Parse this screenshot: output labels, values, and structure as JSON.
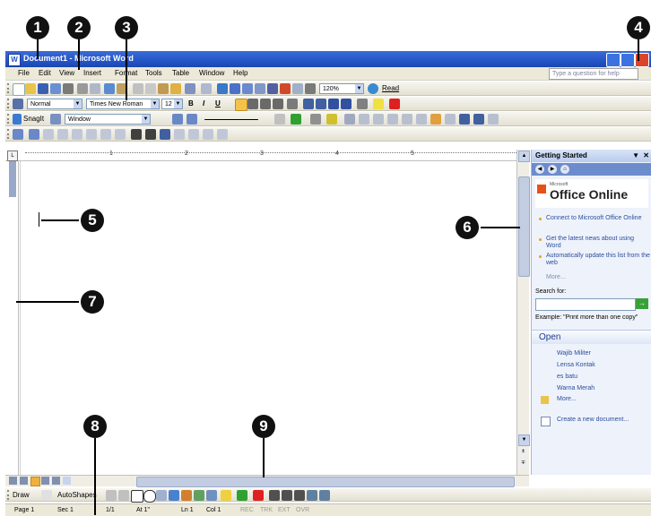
{
  "window": {
    "title": "Document1 - Microsoft Word",
    "app_icon": "W"
  },
  "menu": [
    "File",
    "Edit",
    "View",
    "Insert",
    "Format",
    "Tools",
    "Table",
    "Window",
    "Help"
  ],
  "ask_placeholder": "Type a question for help",
  "formatting": {
    "style": "Normal",
    "font": "Times New Roman",
    "size": "12",
    "bold": "B",
    "italic": "I",
    "underline": "U"
  },
  "standard": {
    "zoom": "120%",
    "read_label": "Read"
  },
  "snagit": {
    "label": "SnagIt",
    "capture": "Window"
  },
  "ruler_numbers": [
    "1",
    "2",
    "3",
    "4",
    "5"
  ],
  "task_pane": {
    "title": "Getting Started",
    "logo_small": "Microsoft",
    "logo": "Office Online",
    "links": [
      "Connect to Microsoft Office Online",
      "Get the latest news about using Word",
      "Automatically update this list from the web",
      "More..."
    ],
    "search_label": "Search for:",
    "search_go": "→",
    "example": "Example:  \"Print more than one copy\"",
    "open_title": "Open",
    "files": [
      "Wajib Militer",
      "Lensa Kontak",
      "es batu",
      "Warna Merah",
      "More..."
    ],
    "create": "Create a new document..."
  },
  "draw_toolbar": {
    "draw": "Draw",
    "autoshapes": "AutoShapes"
  },
  "status": {
    "page": "Page 1",
    "sec": "Sec 1",
    "pages": "1/1",
    "at": "At 1\"",
    "ln": "Ln 1",
    "col": "Col 1",
    "rec": "REC",
    "trk": "TRK",
    "ext": "EXT",
    "ovr": "OVR"
  },
  "callouts": [
    "1",
    "2",
    "3",
    "4",
    "5",
    "6",
    "7",
    "8",
    "9"
  ],
  "colors": {
    "title_bar": "#2456c8",
    "close_button": "#d9442a",
    "chrome": "#ece9d8",
    "task_pane": "#eef2fb"
  }
}
